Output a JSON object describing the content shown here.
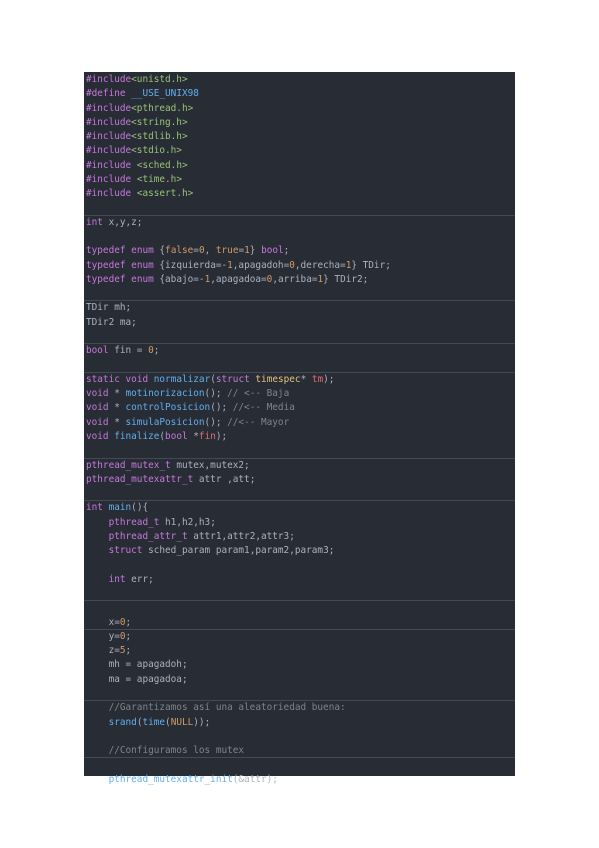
{
  "colors": {
    "background": "#282c34",
    "plain": "#abb2bf",
    "keyword": "#c678dd",
    "string": "#98c379",
    "number": "#d19a66",
    "function": "#61afef",
    "type": "#e5c07b",
    "comment": "#7f848e",
    "variable": "#e06c75"
  },
  "lines": [
    [
      [
        "k",
        "#include"
      ],
      [
        "s",
        "<unistd.h>"
      ]
    ],
    [
      [
        "k",
        "#define"
      ],
      [
        "p",
        " "
      ],
      [
        "f",
        "__USE_UNIX98"
      ]
    ],
    [
      [
        "k",
        "#include"
      ],
      [
        "s",
        "<pthread.h>"
      ]
    ],
    [
      [
        "k",
        "#include"
      ],
      [
        "s",
        "<string.h>"
      ]
    ],
    [
      [
        "k",
        "#include"
      ],
      [
        "s",
        "<stdlib.h>"
      ]
    ],
    [
      [
        "k",
        "#include"
      ],
      [
        "s",
        "<stdio.h>"
      ]
    ],
    [
      [
        "k",
        "#include"
      ],
      [
        "p",
        " "
      ],
      [
        "s",
        "<sched.h>"
      ]
    ],
    [
      [
        "k",
        "#include"
      ],
      [
        "p",
        " "
      ],
      [
        "s",
        "<time.h>"
      ]
    ],
    [
      [
        "k",
        "#include"
      ],
      [
        "p",
        " "
      ],
      [
        "s",
        "<assert.h>"
      ]
    ],
    [],
    [
      [
        "k",
        "int"
      ],
      [
        "p",
        " x,y,z;"
      ]
    ],
    [],
    [
      [
        "k",
        "typedef"
      ],
      [
        "p",
        " "
      ],
      [
        "k",
        "enum"
      ],
      [
        "p",
        " {"
      ],
      [
        "n",
        "false"
      ],
      [
        "p",
        "="
      ],
      [
        "n",
        "0"
      ],
      [
        "p",
        ", "
      ],
      [
        "n",
        "true"
      ],
      [
        "p",
        "="
      ],
      [
        "n",
        "1"
      ],
      [
        "p",
        "} "
      ],
      [
        "k",
        "bool"
      ],
      [
        "p",
        ";"
      ]
    ],
    [
      [
        "k",
        "typedef"
      ],
      [
        "p",
        " "
      ],
      [
        "k",
        "enum"
      ],
      [
        "p",
        " {izquierda=-"
      ],
      [
        "n",
        "1"
      ],
      [
        "p",
        ",apagadoh="
      ],
      [
        "n",
        "0"
      ],
      [
        "p",
        ",derecha="
      ],
      [
        "n",
        "1"
      ],
      [
        "p",
        "} TDir;"
      ]
    ],
    [
      [
        "k",
        "typedef"
      ],
      [
        "p",
        " "
      ],
      [
        "k",
        "enum"
      ],
      [
        "p",
        " {abajo=-"
      ],
      [
        "n",
        "1"
      ],
      [
        "p",
        ",apagadoa="
      ],
      [
        "n",
        "0"
      ],
      [
        "p",
        ",arriba="
      ],
      [
        "n",
        "1"
      ],
      [
        "p",
        "} TDir2;"
      ]
    ],
    [],
    [
      [
        "p",
        "TDir mh;"
      ]
    ],
    [
      [
        "p",
        "TDir2 ma;"
      ]
    ],
    [],
    [
      [
        "k",
        "bool"
      ],
      [
        "p",
        " fin = "
      ],
      [
        "n",
        "0"
      ],
      [
        "p",
        ";"
      ]
    ],
    [],
    [
      [
        "k",
        "static"
      ],
      [
        "p",
        " "
      ],
      [
        "k",
        "void"
      ],
      [
        "p",
        " "
      ],
      [
        "f",
        "normalizar"
      ],
      [
        "p",
        "("
      ],
      [
        "k",
        "struct"
      ],
      [
        "p",
        " "
      ],
      [
        "t",
        "timespec"
      ],
      [
        "p",
        "* "
      ],
      [
        "v",
        "tm"
      ],
      [
        "p",
        ");"
      ]
    ],
    [
      [
        "k",
        "void"
      ],
      [
        "p",
        " * "
      ],
      [
        "f",
        "motinorizacion"
      ],
      [
        "p",
        "(); "
      ],
      [
        "c",
        "// <-- Baja"
      ]
    ],
    [
      [
        "k",
        "void"
      ],
      [
        "p",
        " * "
      ],
      [
        "f",
        "controlPosicion"
      ],
      [
        "p",
        "(); "
      ],
      [
        "c",
        "//<-- Media"
      ]
    ],
    [
      [
        "k",
        "void"
      ],
      [
        "p",
        " * "
      ],
      [
        "f",
        "simulaPosicion"
      ],
      [
        "p",
        "(); "
      ],
      [
        "c",
        "//<-- Mayor"
      ]
    ],
    [
      [
        "k",
        "void"
      ],
      [
        "p",
        " "
      ],
      [
        "f",
        "finalize"
      ],
      [
        "p",
        "("
      ],
      [
        "k",
        "bool"
      ],
      [
        "p",
        " *"
      ],
      [
        "v",
        "fin"
      ],
      [
        "p",
        ");"
      ]
    ],
    [],
    [
      [
        "k",
        "pthread_mutex_t"
      ],
      [
        "p",
        " mutex,mutex2;"
      ]
    ],
    [
      [
        "k",
        "pthread_mutexattr_t"
      ],
      [
        "p",
        " attr ,att;"
      ]
    ],
    [],
    [
      [
        "k",
        "int"
      ],
      [
        "p",
        " "
      ],
      [
        "f",
        "main"
      ],
      [
        "p",
        "(){"
      ]
    ],
    [
      [
        "p",
        "    "
      ],
      [
        "k",
        "pthread_t"
      ],
      [
        "p",
        " h1,h2,h3;"
      ]
    ],
    [
      [
        "p",
        "    "
      ],
      [
        "k",
        "pthread_attr_t"
      ],
      [
        "p",
        " attr1,attr2,attr3;"
      ]
    ],
    [
      [
        "p",
        "    "
      ],
      [
        "k",
        "struct"
      ],
      [
        "p",
        " sched_param param1,param2,param3;"
      ]
    ],
    [],
    [
      [
        "p",
        "    "
      ],
      [
        "k",
        "int"
      ],
      [
        "p",
        " err;"
      ]
    ],
    [],
    [],
    [
      [
        "p",
        "    x="
      ],
      [
        "n",
        "0"
      ],
      [
        "p",
        ";"
      ]
    ],
    [
      [
        "p",
        "    y="
      ],
      [
        "n",
        "0"
      ],
      [
        "p",
        ";"
      ]
    ],
    [
      [
        "p",
        "    z="
      ],
      [
        "n",
        "5"
      ],
      [
        "p",
        ";"
      ]
    ],
    [
      [
        "p",
        "    mh = apagadoh;"
      ]
    ],
    [
      [
        "p",
        "    ma = apagadoa;"
      ]
    ],
    [],
    [
      [
        "p",
        "    "
      ],
      [
        "c",
        "//Garantizamos así una aleatoriedad buena:"
      ]
    ],
    [
      [
        "p",
        "    "
      ],
      [
        "f",
        "srand"
      ],
      [
        "p",
        "("
      ],
      [
        "f",
        "time"
      ],
      [
        "p",
        "("
      ],
      [
        "n",
        "NULL"
      ],
      [
        "p",
        "));"
      ]
    ],
    [],
    [
      [
        "p",
        "    "
      ],
      [
        "c",
        "//Configuramos los mutex"
      ]
    ],
    [],
    [
      [
        "p",
        "    "
      ],
      [
        "f",
        "pthread_mutexattr_init"
      ],
      [
        "p",
        "(&attr);"
      ]
    ]
  ]
}
